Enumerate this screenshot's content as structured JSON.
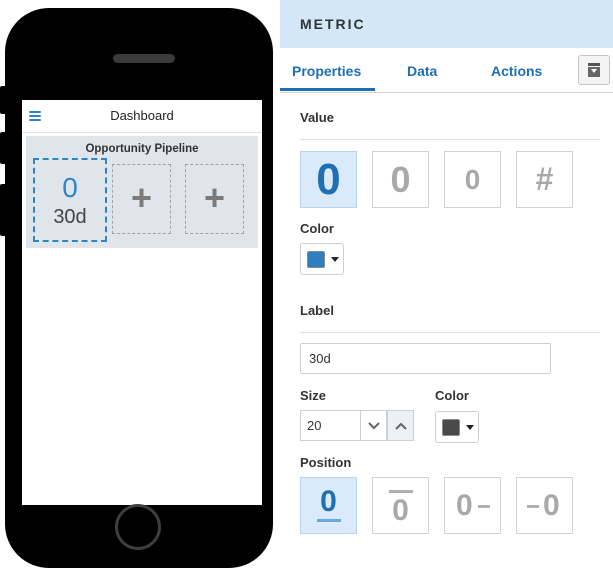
{
  "phone": {
    "app_title": "Dashboard",
    "card": {
      "title": "Opportunity Pipeline",
      "metric_value": "0",
      "metric_label": "30d",
      "empty_slot_symbol": "+"
    }
  },
  "panel": {
    "title": "METRIC",
    "tabs": [
      {
        "label": "Properties",
        "active": true
      },
      {
        "label": "Data",
        "active": false
      },
      {
        "label": "Actions",
        "active": false
      }
    ],
    "value_section": {
      "label": "Value",
      "styles": [
        {
          "glyph": "0",
          "selected": true
        },
        {
          "glyph": "0",
          "selected": false
        },
        {
          "glyph": "0",
          "selected": false
        },
        {
          "glyph": "#",
          "selected": false
        }
      ]
    },
    "value_color": {
      "label": "Color",
      "color": "#2d7fbf"
    },
    "label_section": {
      "label": "Label",
      "text_value": "30d",
      "size_label": "Size",
      "size_value": "20",
      "color_label": "Color",
      "color": "#4a4a4a"
    },
    "position_section": {
      "label": "Position",
      "options": [
        {
          "glyph": "0",
          "selected": true
        },
        {
          "glyph": "0",
          "selected": false
        },
        {
          "glyph": "0",
          "selected": false
        },
        {
          "glyph": "0",
          "selected": false
        }
      ]
    }
  },
  "colors": {
    "accent": "#1f6fb5",
    "header_bg": "#d3e7f8",
    "selected_bg": "#dbeafa",
    "card_bg": "#dfe5eb"
  }
}
